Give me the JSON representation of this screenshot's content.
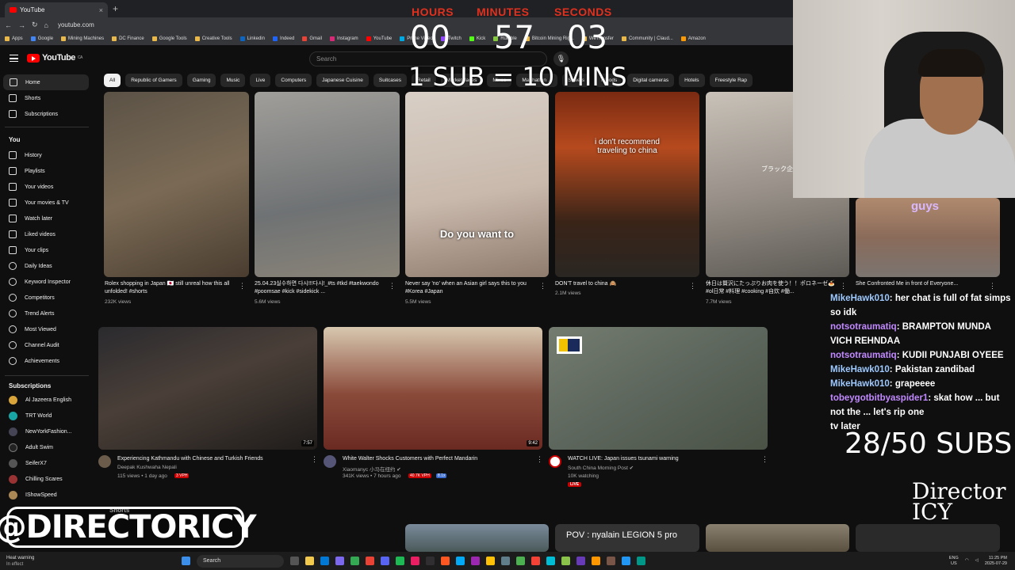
{
  "browser": {
    "tab_title": "YouTube",
    "new_tab": "+",
    "close": "×",
    "url": "youtube.com",
    "bookmarks": [
      "Apps",
      "Google",
      "Mining Machines",
      "DC Finance",
      "Google Tools",
      "Creative Tools",
      "Linkedin",
      "Indeed",
      "Gmail",
      "Instagram",
      "YouTube",
      "Prime Video",
      "Twitch",
      "Kick",
      "Rumble",
      "Bitcoin Mining Rig...",
      "WeTransfer",
      "Community | Claud...",
      "Amazon"
    ]
  },
  "youtube": {
    "logo": "YouTube",
    "region": "CA",
    "search_placeholder": "Search",
    "sidebar": {
      "main": [
        "Home",
        "Shorts",
        "Subscriptions"
      ],
      "you_header": "You",
      "you": [
        "History",
        "Playlists",
        "Your videos",
        "Your movies & TV",
        "Watch later",
        "Liked videos",
        "Your clips",
        "Daily Ideas",
        "Keyword Inspector",
        "Competitors",
        "Trend Alerts",
        "Most Viewed",
        "Channel Audit",
        "Achievements"
      ],
      "subs_header": "Subscriptions",
      "subs": [
        "Al Jazeera English",
        "TRT World",
        "NewYorkFashion...",
        "Adult Swim",
        "SeiferX7",
        "Chilling Scares",
        "IShowSpeed"
      ]
    },
    "chips": [
      "All",
      "Republic of Gamers",
      "Gaming",
      "Music",
      "Live",
      "Computers",
      "Japanese Cuisine",
      "Suitcases",
      "Retail",
      "Marketplaces",
      "Mixes",
      "Manhattan ...",
      "Streets",
      "Tripods",
      "Digital cameras",
      "Hotels",
      "Freestyle Rap"
    ],
    "shorts": [
      {
        "title": "Rolex shopping in Japan 🇯🇵 still unreal how this all unfolded! #shorts",
        "views": "232K views",
        "color": "#7a6a55"
      },
      {
        "title": "25.04.23실수하면 다시!!!다시!_#ts #tkd #taekwondo #poomsae #kick #sidekick ...",
        "views": "5.6M views",
        "color": "#8a8a88"
      },
      {
        "title": "Never say 'no' when an Asian girl says this to you #Korea #Japan",
        "views": "5.5M views",
        "color": "#c9b9ac",
        "overlay": "Do you want to"
      },
      {
        "title": "DON'T travel to china 🙈",
        "views": "2.1M views",
        "color": "#5a3320",
        "overlay": "i don't recommend traveling to china"
      },
      {
        "title": "休日は贅沢にたっぷりお肉を使う！！ポロネーゼ🍝 #ol日常 #料理 #cooking #自炊 #働...",
        "views": "7.7M views",
        "color": "#9a928a",
        "overlay": "ブラック企業OL"
      },
      {
        "title": "She Confronted Me in front of Everyone...",
        "views": "",
        "color": "#8a6b5a",
        "overlay": "guys"
      }
    ],
    "videos": [
      {
        "title": "Experiencing Kathmandu with Chinese and Turkish Friends",
        "channel": "Deepak Kushwaha Nepali",
        "meta": "115 views • 1 day ago",
        "badge": "3 VPH",
        "duration": "7:57",
        "color": "#3a3530"
      },
      {
        "title": "White Walter Shocks Customers with Perfect Mandarin",
        "channel": "Xiaomanyc 小马在纽约 ✔",
        "meta": "341K views • 7 hours ago",
        "badge": "40.7K VPH",
        "badge2": "8.1x",
        "duration": "9:42",
        "color": "#6a2a22"
      },
      {
        "title": "WATCH LIVE: Japan issues tsunami warning",
        "channel": "South China Morning Post ✔",
        "meta": "10K watching",
        "badge": "LIVE",
        "color": "#5d665c"
      }
    ],
    "shorts_header": "Shorts",
    "bottom_overlay": "POV : nyalain LEGION 5 pro"
  },
  "stream": {
    "timer_labels": [
      "HOURS",
      "MINUTES",
      "SECONDS"
    ],
    "timer_values": [
      "00",
      "57",
      "03"
    ],
    "sub_rule": "1 SUB = 10 MINS",
    "sub_goal": "28/50 SUBS",
    "handle": "@DIRECTORICY",
    "logo_text": "Director ICY",
    "chat": [
      {
        "user": "MikeHawk010",
        "msg": ": her chat is full of fat simps so idk"
      },
      {
        "user": "notsotraumatiq",
        "msg": ": BRAMPTON MUNDA VICH REHNDAA"
      },
      {
        "user": "notsotraumatiq",
        "msg": ": KUDII PUNJABI OYEEE"
      },
      {
        "user": "MikeHawk010",
        "msg": ": Pakistan zandibad"
      },
      {
        "user": "MikeHawk010",
        "msg": ": grapeeee"
      },
      {
        "user": "tobeygotbitbyaspider1",
        "msg": ": skat how ... but not the ... let's rip one"
      },
      {
        "user": "",
        "msg": "tv later"
      }
    ]
  },
  "taskbar": {
    "weather": "Heat warning",
    "weather_sub": "In effect",
    "search": "Search",
    "lang": "ENG",
    "region": "US",
    "time": "11:25 PM",
    "date": "2025-07-29"
  }
}
